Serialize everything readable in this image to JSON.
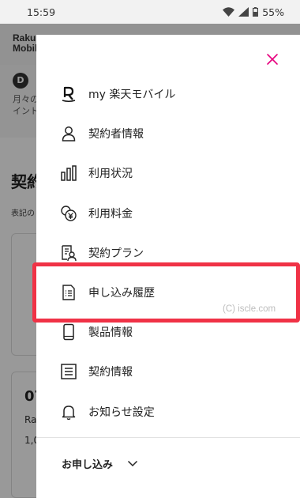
{
  "status_bar": {
    "time": "15:59",
    "battery": "55%"
  },
  "background": {
    "logo_line1": "Raku",
    "logo_line2": "Mobil",
    "banner_lines": [
      "月々の",
      "イント"
    ],
    "title": "契約",
    "subtitle": "表記の",
    "card_number": "07",
    "card_line1": "Ra",
    "card_line2": "1,0"
  },
  "drawer": {
    "menu": [
      {
        "label": "my 楽天モバイル",
        "icon": "rakuten-r-icon"
      },
      {
        "label": "契約者情報",
        "icon": "person-icon"
      },
      {
        "label": "利用状況",
        "icon": "bar-chart-icon"
      },
      {
        "label": "利用料金",
        "icon": "yen-coins-icon"
      },
      {
        "label": "契約プラン",
        "icon": "plan-document-icon"
      },
      {
        "label": "申し込み履歴",
        "icon": "history-document-icon"
      },
      {
        "label": "製品情報",
        "icon": "smartphone-icon"
      },
      {
        "label": "契約情報",
        "icon": "contract-document-icon"
      },
      {
        "label": "お知らせ設定",
        "icon": "bell-icon"
      }
    ],
    "section_label": "お申し込み",
    "watermark": "(C) iscle.com"
  },
  "colors": {
    "accent": "#e6007e",
    "highlight": "#f03246"
  }
}
